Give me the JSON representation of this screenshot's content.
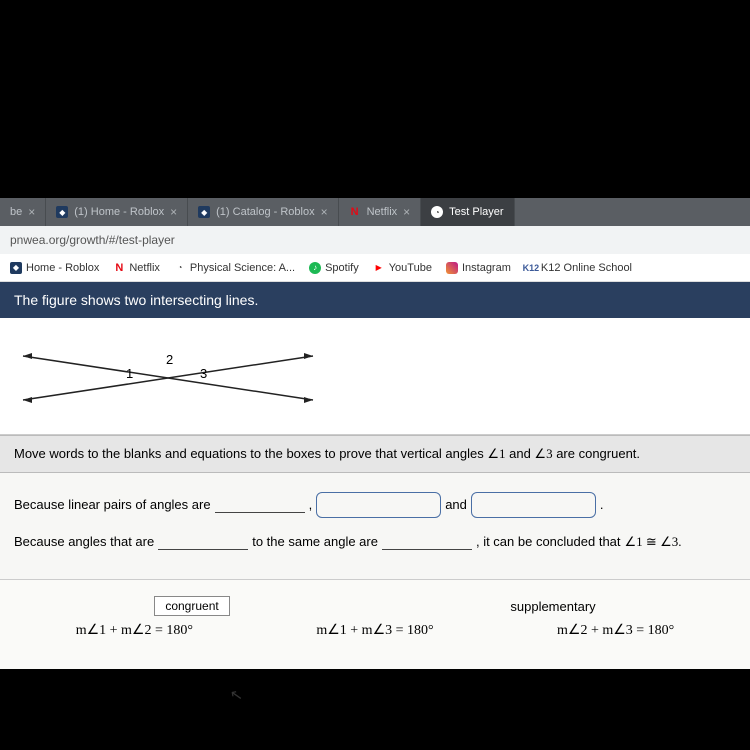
{
  "tabs": [
    {
      "label": "be",
      "close": "×"
    },
    {
      "label": "(1) Home - Roblox",
      "favicon": "f-rob",
      "close": "×"
    },
    {
      "label": "(1) Catalog - Roblox",
      "favicon": "f-rob",
      "close": "×"
    },
    {
      "label": "Netflix",
      "favicon": "f-net",
      "close": "×"
    },
    {
      "label": "Test Player",
      "favicon": "f-play",
      "active": true
    }
  ],
  "url": "pnwea.org/growth/#/test-player",
  "bookmarks": [
    {
      "label": "Home - Roblox",
      "favicon": "f-rob"
    },
    {
      "label": "Netflix",
      "favicon": "f-net"
    },
    {
      "label": "Physical Science: A...",
      "favicon": "f-play"
    },
    {
      "label": "Spotify",
      "favicon": "f-spot"
    },
    {
      "label": "YouTube",
      "favicon": "f-yt"
    },
    {
      "label": "Instagram",
      "favicon": "f-ig"
    },
    {
      "label": "K12 Online School",
      "favicon": "f-k12",
      "prefix": "K12"
    }
  ],
  "banner": "The figure shows two intersecting lines.",
  "figure": {
    "labels": {
      "a1": "1",
      "a2": "2",
      "a3": "3"
    }
  },
  "instruction": {
    "pre": "Move words to the blanks and equations to the boxes to prove that vertical angles ",
    "ang1": "∠1",
    "mid": " and ",
    "ang3": "∠3",
    "post": " are congruent."
  },
  "proof": {
    "l1": "Because linear pairs of angles are ",
    "and": "and",
    "l2a": "Because angles that are ",
    "l2b": " to the same angle are ",
    "l2c": ", it can be concluded that ",
    "concl": "∠1 ≅ ∠3.",
    "dot": "."
  },
  "choices": {
    "congruent": "congruent",
    "supplementary": "supplementary",
    "eq1": "m∠1 + m∠2 = 180°",
    "eq2": "m∠1 + m∠3 = 180°",
    "eq3": "m∠2 + m∠3 = 180°"
  },
  "chart_data": {
    "type": "other",
    "description": "Two intersecting lines forming an X shape. Angle 1 is the left region, angle 2 is the top region, angle 3 is the right region between the lines.",
    "labels": [
      "1",
      "2",
      "3"
    ]
  }
}
